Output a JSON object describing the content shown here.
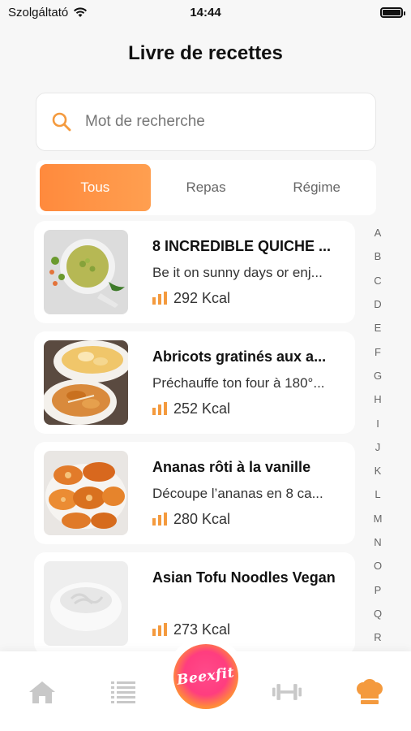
{
  "status_bar": {
    "carrier": "Szolgáltató",
    "time": "14:44"
  },
  "page": {
    "title": "Livre de recettes"
  },
  "search": {
    "placeholder": "Mot de recherche",
    "value": ""
  },
  "tabs": [
    {
      "label": "Tous",
      "active": true
    },
    {
      "label": "Repas",
      "active": false
    },
    {
      "label": "Régime",
      "active": false
    }
  ],
  "recipes": [
    {
      "title": "8 INCREDIBLE QUICHE ...",
      "description": "Be it on sunny days or enj...",
      "kcal": "292 Kcal",
      "image": "green-soup-bowl"
    },
    {
      "title": "Abricots gratinés aux a...",
      "description": "Préchauffe ton four à 180°...",
      "kcal": "252 Kcal",
      "image": "apricot-gratin"
    },
    {
      "title": "Ananas rôti à la vanille",
      "description": "Découpe l’ananas en 8 ca...",
      "kcal": "280 Kcal",
      "image": "roasted-pineapple"
    },
    {
      "title": "Asian Tofu Noodles Vegan",
      "description": "",
      "kcal": "273 Kcal",
      "image": "noodle-bowl-placeholder"
    }
  ],
  "alpha_index": [
    "A",
    "B",
    "C",
    "D",
    "E",
    "F",
    "G",
    "H",
    "I",
    "J",
    "K",
    "L",
    "M",
    "N",
    "O",
    "P",
    "Q",
    "R"
  ],
  "bottom_nav": {
    "items": [
      "home-icon",
      "list-icon",
      "dumbbell-icon",
      "chef-hat-icon"
    ],
    "logo_text": "Beexfit",
    "active": "chef-hat-icon"
  },
  "colors": {
    "accent": "#ff8a3d",
    "inactive": "#c8c8c8"
  }
}
